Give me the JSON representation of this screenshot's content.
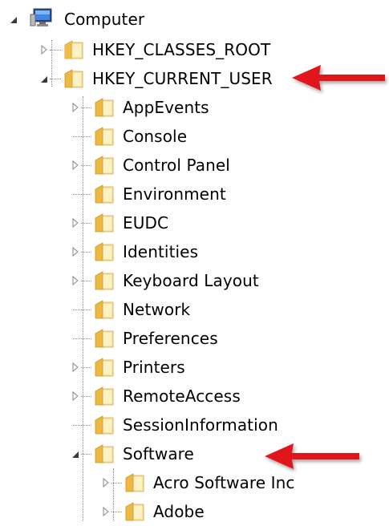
{
  "root": {
    "label": "Computer",
    "icon": "computer-icon",
    "expanded": true
  },
  "hives": [
    {
      "label": "HKEY_CLASSES_ROOT",
      "expanded": false,
      "has_children": true
    },
    {
      "label": "HKEY_CURRENT_USER",
      "expanded": true,
      "has_children": true,
      "highlighted_by_arrow": true
    }
  ],
  "hkcu_children": [
    {
      "label": "AppEvents",
      "has_children": true
    },
    {
      "label": "Console",
      "has_children": false
    },
    {
      "label": "Control Panel",
      "has_children": true
    },
    {
      "label": "Environment",
      "has_children": false
    },
    {
      "label": "EUDC",
      "has_children": true
    },
    {
      "label": "Identities",
      "has_children": true
    },
    {
      "label": "Keyboard Layout",
      "has_children": true
    },
    {
      "label": "Network",
      "has_children": false
    },
    {
      "label": "Preferences",
      "has_children": false
    },
    {
      "label": "Printers",
      "has_children": true
    },
    {
      "label": "RemoteAccess",
      "has_children": true
    },
    {
      "label": "SessionInformation",
      "has_children": false
    },
    {
      "label": "Software",
      "has_children": true,
      "expanded": true,
      "highlighted_by_arrow": true
    }
  ],
  "software_children": [
    {
      "label": "Acro Software Inc",
      "has_children": true
    },
    {
      "label": "Adobe",
      "has_children": true
    }
  ],
  "colors": {
    "annotation_arrow": "#e0141b",
    "folder_light": "#fbe6a2",
    "folder_dark": "#d9a93a",
    "tree_line": "#8a8a8a",
    "expander_collapsed": "#9a9a9a",
    "expander_expanded": "#3a3a3a"
  }
}
